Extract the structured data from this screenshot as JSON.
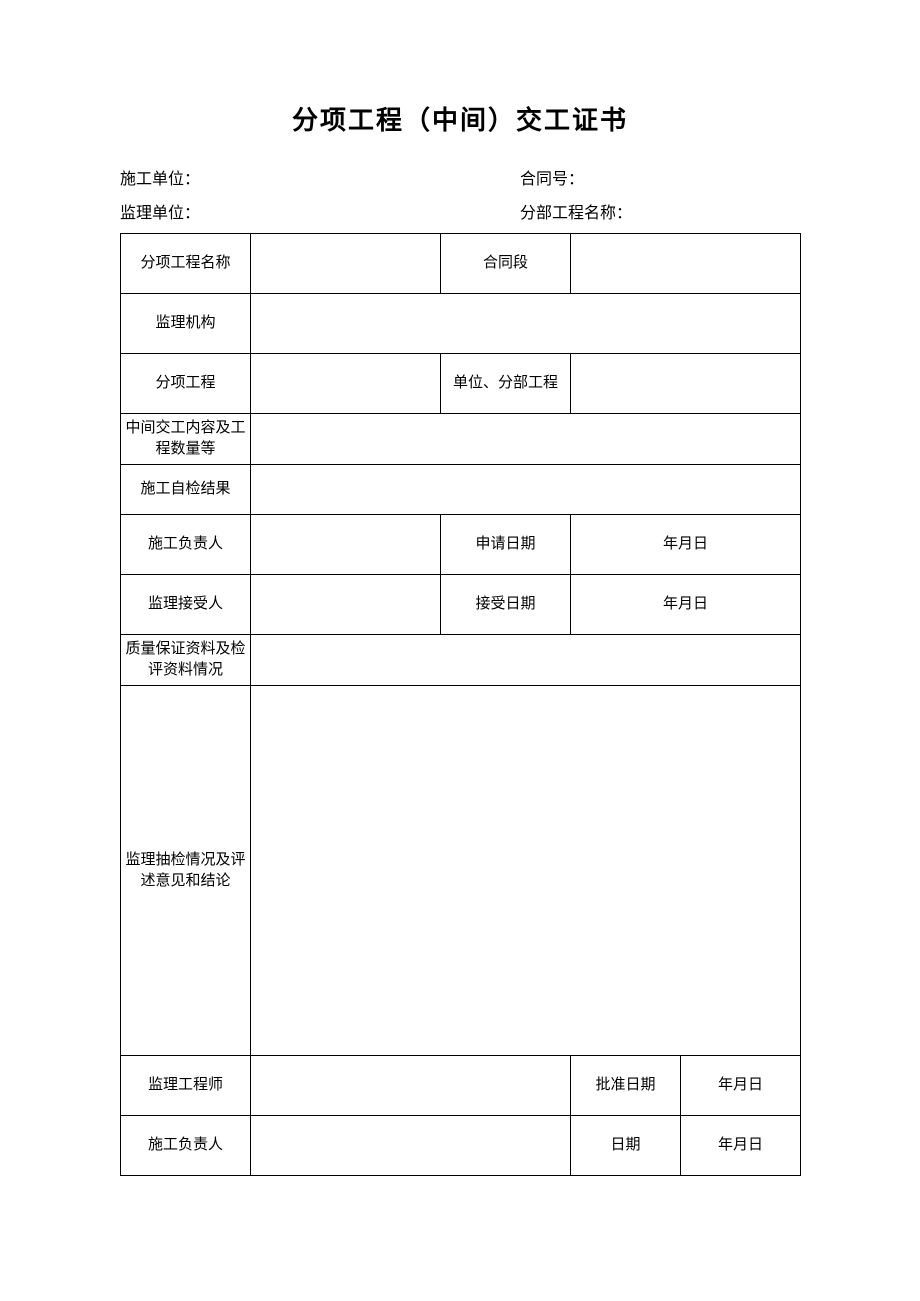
{
  "title": "分项工程（中间）交工证书",
  "header": {
    "construction_unit_label": "施工单位：",
    "contract_no_label": "合同号：",
    "supervision_unit_label": "监理单位：",
    "subproject_name_label": "分部工程名称："
  },
  "rows": {
    "r1c1": "分项工程名称",
    "r1c2": "",
    "r1c3": "合同段",
    "r1c4": "",
    "r2c1": "监理机构",
    "r2c2": "",
    "r3c1": "分项工程",
    "r3c2": "",
    "r3c3": "单位、分部工程",
    "r3c4": "",
    "r4c1": "中间交工内容及工程数量等",
    "r4c2": "",
    "r5c1": "施工自检结果",
    "r5c2": "",
    "r6c1": "施工负责人",
    "r6c2": "",
    "r6c3": "申请日期",
    "r6c4": "年月日",
    "r7c1": "监理接受人",
    "r7c2": "",
    "r7c3": "接受日期",
    "r7c4": "年月日",
    "r8c1": "质量保证资料及检评资料情况",
    "r8c2": "",
    "r9c1": "监理抽检情况及评述意见和结论",
    "r9c2": "",
    "r10c1": "监理工程师",
    "r10c2": "",
    "r10c3": "批准日期",
    "r10c4": "年月日",
    "r11c1": "施工负责人",
    "r11c2": "",
    "r11c3": "日期",
    "r11c4": "年月日"
  }
}
